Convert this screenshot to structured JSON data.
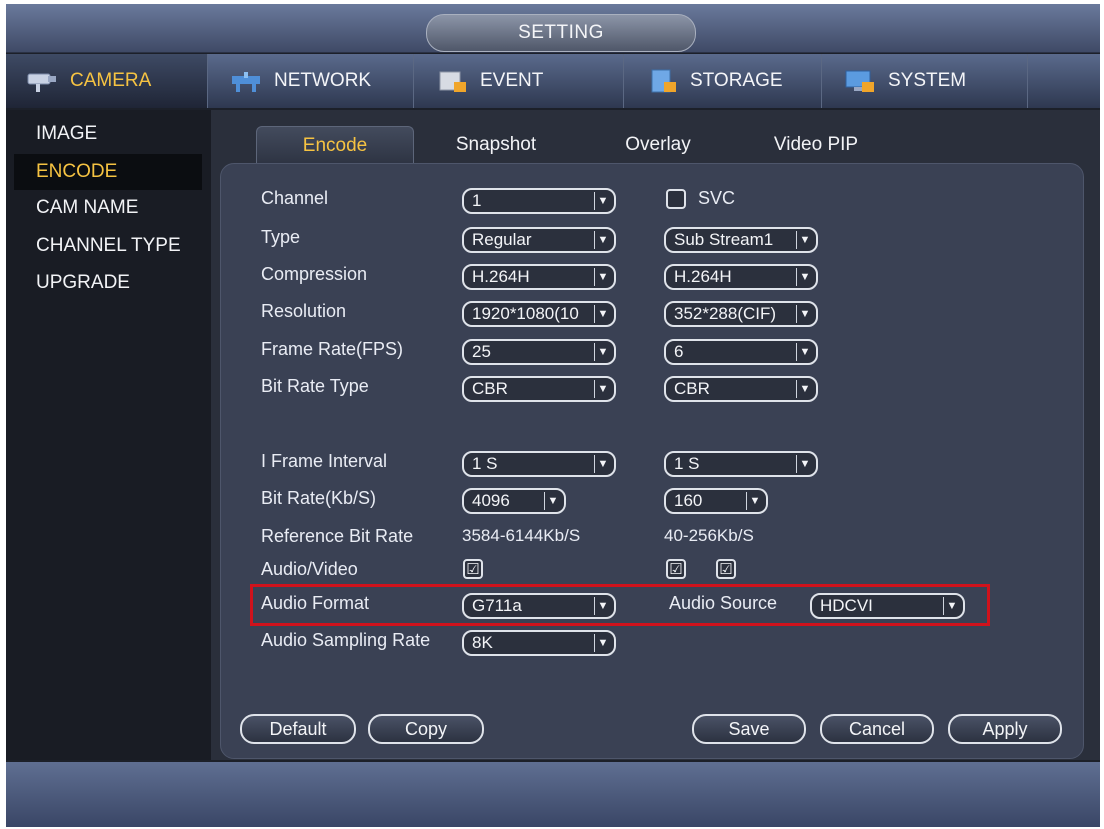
{
  "window": {
    "title": "SETTING"
  },
  "menu": [
    {
      "label": "CAMERA",
      "icon": "camera-icon",
      "active": true
    },
    {
      "label": "NETWORK",
      "icon": "network-icon"
    },
    {
      "label": "EVENT",
      "icon": "event-icon"
    },
    {
      "label": "STORAGE",
      "icon": "storage-icon"
    },
    {
      "label": "SYSTEM",
      "icon": "system-icon"
    }
  ],
  "sidebar": {
    "items": [
      {
        "label": "IMAGE"
      },
      {
        "label": "ENCODE",
        "active": true
      },
      {
        "label": "CAM NAME"
      },
      {
        "label": "CHANNEL TYPE"
      },
      {
        "label": "UPGRADE"
      }
    ]
  },
  "tabs": [
    {
      "label": "Encode",
      "active": true
    },
    {
      "label": "Snapshot"
    },
    {
      "label": "Overlay"
    },
    {
      "label": "Video PIP"
    }
  ],
  "form": {
    "channel": {
      "label": "Channel",
      "value": "1"
    },
    "svc_label": "SVC",
    "type": {
      "label": "Type",
      "main": "Regular",
      "sub": "Sub Stream1"
    },
    "compression": {
      "label": "Compression",
      "main": "H.264H",
      "sub": "H.264H"
    },
    "resolution": {
      "label": "Resolution",
      "main": "1920*1080(10",
      "sub": "352*288(CIF)"
    },
    "frame_rate": {
      "label": "Frame Rate(FPS)",
      "main": "25",
      "sub": "6"
    },
    "bit_rate_type": {
      "label": "Bit Rate Type",
      "main": "CBR",
      "sub": "CBR"
    },
    "i_frame": {
      "label": "I Frame Interval",
      "main": "1 S",
      "sub": "1 S"
    },
    "bit_rate": {
      "label": "Bit Rate(Kb/S)",
      "main": "4096",
      "sub": "160"
    },
    "ref_bit_rate": {
      "label": "Reference Bit Rate",
      "main": "3584-6144Kb/S",
      "sub": "40-256Kb/S"
    },
    "audio_video": {
      "label": "Audio/Video",
      "check": "☑"
    },
    "audio_format": {
      "label": "Audio Format",
      "value": "G711a"
    },
    "audio_source": {
      "label": "Audio Source",
      "value": "HDCVI"
    },
    "audio_sampling": {
      "label": "Audio Sampling Rate",
      "value": "8K"
    }
  },
  "buttons": {
    "default": "Default",
    "copy": "Copy",
    "save": "Save",
    "cancel": "Cancel",
    "apply": "Apply"
  },
  "colors": {
    "accent": "#f6c342",
    "highlight": "#d0121c",
    "panel": "#3a4154"
  }
}
